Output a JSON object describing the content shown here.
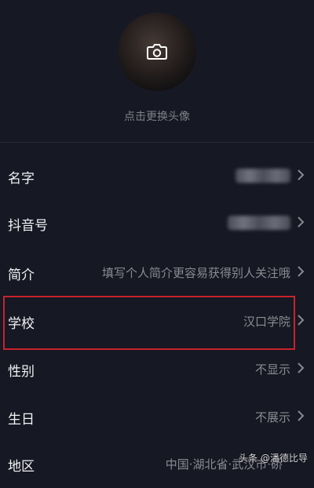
{
  "profile": {
    "change_avatar_label": "点击更换头像"
  },
  "rows": [
    {
      "label": "名字",
      "value": ""
    },
    {
      "label": "抖音号",
      "value": ""
    },
    {
      "label": "简介",
      "value": "填写个人简介更容易获得别人关注哦"
    },
    {
      "label": "学校",
      "value": "汉口学院"
    },
    {
      "label": "性别",
      "value": "不显示"
    },
    {
      "label": "生日",
      "value": "不展示"
    },
    {
      "label": "地区",
      "value": "中国·湖北省·武汉市·硚"
    }
  ],
  "watermark": "头条 @潘德比导",
  "colors": {
    "background": "#161823",
    "highlight": "#c8232c"
  },
  "icons": {
    "camera": "camera-icon",
    "chevron": "chevron-right-icon"
  }
}
